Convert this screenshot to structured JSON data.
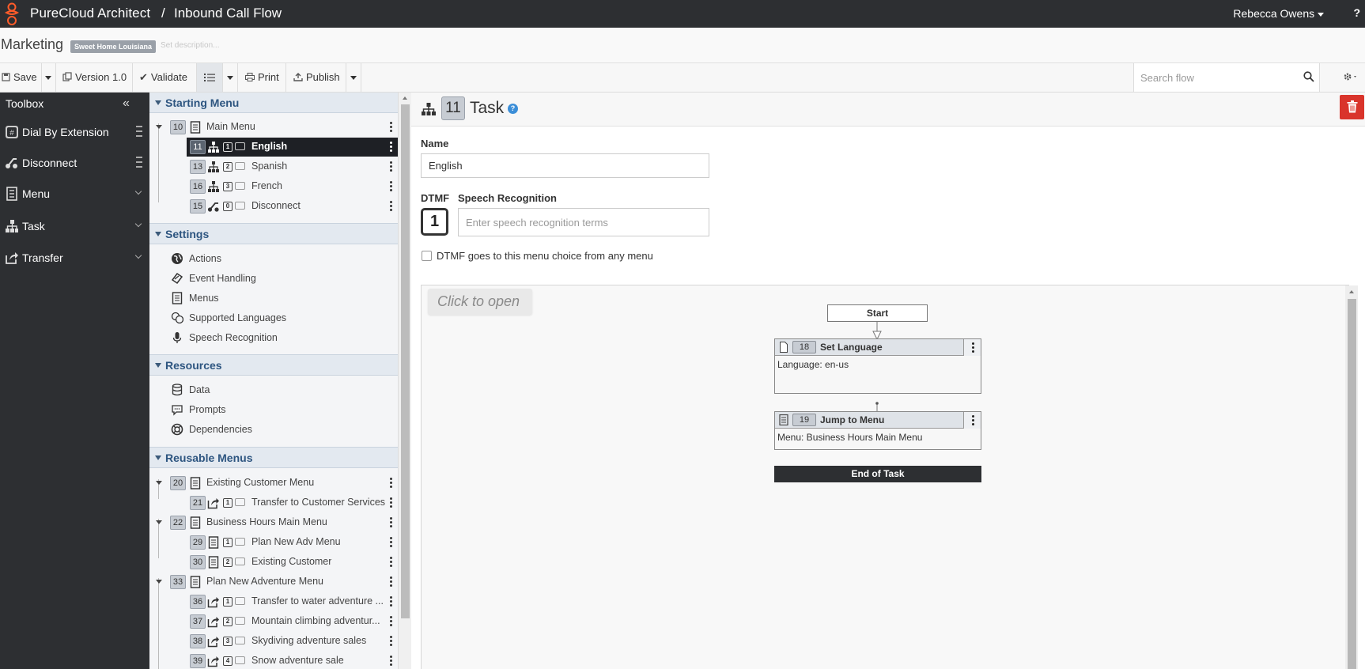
{
  "topbar": {
    "app_title": "PureCloud Architect",
    "separator": "/",
    "flow_title": "Inbound Call Flow",
    "user_name": "Rebecca Owens",
    "help_label": "?"
  },
  "header": {
    "flow_name": "Marketing",
    "division_badge": "Sweet Home Louisiana",
    "description_placeholder": "Set description..."
  },
  "toolbar": {
    "save": "Save",
    "version": "Version 1.0",
    "validate": "Validate",
    "print": "Print",
    "publish": "Publish",
    "search_placeholder": "Search flow"
  },
  "toolbox": {
    "title": "Toolbox",
    "items": [
      {
        "label": "Dial By Extension",
        "icon": "dial-icon",
        "control": "grip"
      },
      {
        "label": "Disconnect",
        "icon": "disconnect-icon",
        "control": "grip"
      },
      {
        "label": "Menu",
        "icon": "menu-list-icon",
        "control": "chevron"
      },
      {
        "label": "Task",
        "icon": "task-icon",
        "control": "chevron"
      },
      {
        "label": "Transfer",
        "icon": "transfer-icon",
        "control": "chevron"
      }
    ]
  },
  "nav": {
    "starting_menu": {
      "title": "Starting Menu",
      "root": {
        "num": "10",
        "label": "Main Menu"
      },
      "children": [
        {
          "num": "11",
          "dtmf": "1",
          "label": "English",
          "type": "task",
          "selected": true
        },
        {
          "num": "13",
          "dtmf": "2",
          "label": "Spanish",
          "type": "task"
        },
        {
          "num": "16",
          "dtmf": "3",
          "label": "French",
          "type": "task"
        },
        {
          "num": "15",
          "dtmf": "0",
          "label": "Disconnect",
          "type": "disconnect"
        }
      ]
    },
    "settings": {
      "title": "Settings",
      "items": [
        "Actions",
        "Event Handling",
        "Menus",
        "Supported Languages",
        "Speech Recognition"
      ]
    },
    "resources": {
      "title": "Resources",
      "items": [
        "Data",
        "Prompts",
        "Dependencies"
      ]
    },
    "reusable_menus": {
      "title": "Reusable Menus",
      "menus": [
        {
          "num": "20",
          "label": "Existing Customer Menu",
          "children": [
            {
              "num": "21",
              "dtmf": "1",
              "label": "Transfer to Customer Services",
              "type": "transfer"
            }
          ]
        },
        {
          "num": "22",
          "label": "Business Hours Main Menu",
          "children": [
            {
              "num": "29",
              "dtmf": "1",
              "label": "Plan New Adv Menu",
              "type": "menu"
            },
            {
              "num": "30",
              "dtmf": "2",
              "label": "Existing Customer",
              "type": "menu"
            }
          ]
        },
        {
          "num": "33",
          "label": "Plan New Adventure Menu",
          "children": [
            {
              "num": "36",
              "dtmf": "1",
              "label": "Transfer to water adventure ...",
              "type": "transfer"
            },
            {
              "num": "37",
              "dtmf": "2",
              "label": "Mountain climbing adventur...",
              "type": "transfer"
            },
            {
              "num": "38",
              "dtmf": "3",
              "label": "Skydiving adventure sales",
              "type": "transfer"
            },
            {
              "num": "39",
              "dtmf": "4",
              "label": "Snow adventure sale",
              "type": "transfer"
            }
          ]
        }
      ]
    }
  },
  "main": {
    "num": "11",
    "title": "Task",
    "name_label": "Name",
    "name_value": "English",
    "dtmf_label": "DTMF",
    "dtmf_value": "1",
    "speech_label": "Speech Recognition",
    "speech_placeholder": "Enter speech recognition terms",
    "checkbox_label": "DTMF goes to this menu choice from any menu",
    "checkbox_checked": false,
    "canvas": {
      "click_to_open": "Click to open",
      "start": "Start",
      "nodes": [
        {
          "num": "18",
          "title": "Set Language",
          "body": "Language: en-us"
        },
        {
          "num": "19",
          "title": "Jump to Menu",
          "body": "Menu: Business Hours Main Menu"
        }
      ],
      "end": "End of Task"
    }
  },
  "colors": {
    "dark": "#2d2f32",
    "section_text": "#2d5580",
    "delete_red": "#d9342b",
    "help_blue": "#3b8ed8"
  }
}
